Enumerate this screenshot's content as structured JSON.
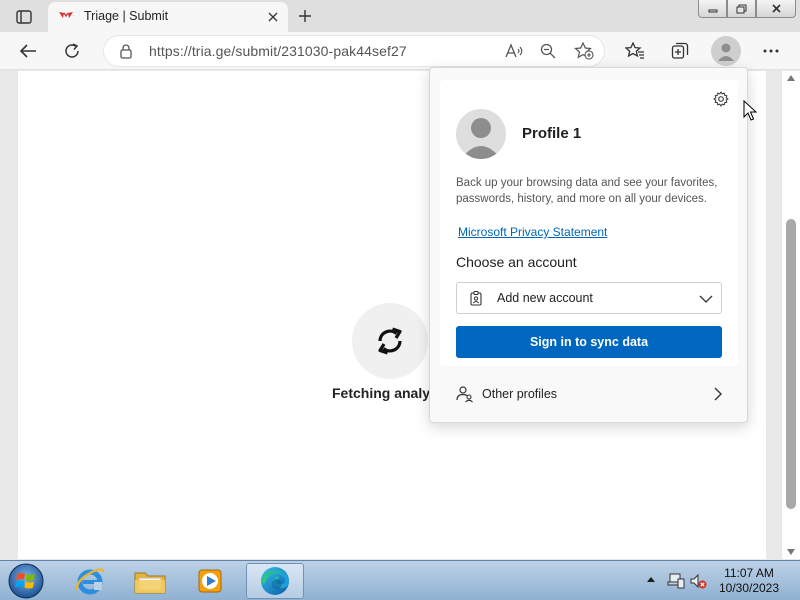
{
  "browser": {
    "tab": {
      "title": "Triage | Submit"
    },
    "address": {
      "url": "https://tria.ge/submit/231030-pak44sef27"
    }
  },
  "page": {
    "loading_text": "Fetching analys"
  },
  "profile_flyout": {
    "profile_name": "Profile 1",
    "description": "Back up your browsing data and see your favorites, passwords, history, and more on all your devices.",
    "privacy_link": "Microsoft Privacy Statement",
    "choose_account_label": "Choose an account",
    "account_dropdown_value": "Add new account",
    "sync_button_label": "Sign in to sync data",
    "other_profiles_label": "Other profiles"
  },
  "taskbar": {
    "time": "11:07 AM",
    "date": "10/30/2023"
  },
  "colors": {
    "accent": "#0067c0",
    "link": "#0067b8"
  },
  "icons": [
    "tab-actions-icon",
    "triage-favicon-icon",
    "close-icon",
    "plus-icon",
    "minimize-icon",
    "restore-icon",
    "window-close-icon",
    "back-arrow-icon",
    "refresh-icon",
    "lock-icon",
    "read-aloud-icon",
    "zoom-out-icon",
    "add-favorite-icon",
    "favorites-icon",
    "collections-icon",
    "profile-icon",
    "more-icon",
    "gear-icon",
    "person-icon",
    "account-badge-icon",
    "chevron-down-icon",
    "people-icon",
    "chevron-right-icon",
    "sync-icon",
    "windows-start-icon",
    "internet-explorer-icon",
    "file-explorer-icon",
    "media-player-icon",
    "edge-icon",
    "tray-arrow-icon",
    "network-icon",
    "volume-muted-icon"
  ]
}
